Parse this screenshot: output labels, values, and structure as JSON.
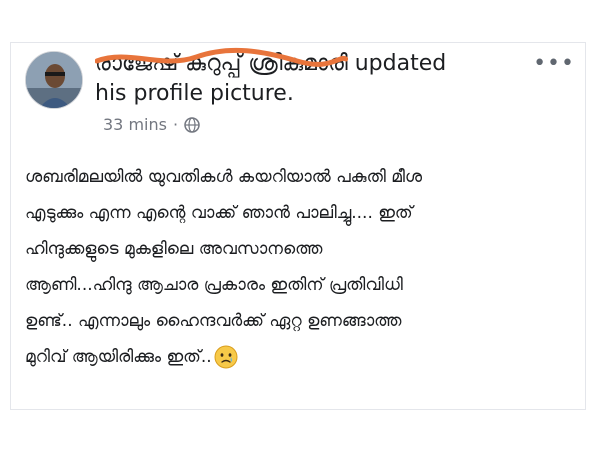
{
  "post": {
    "author_name": "രാജേഷ് കുറുപ്പ് ശ്രീകുമാരി",
    "action_text_1": "updated",
    "action_text_2": "his profile picture.",
    "timestamp": "33 mins",
    "separator": "·",
    "privacy_icon": "globe-icon",
    "more_label": "•••",
    "body_lines": [
      "ശബരിമലയിൽ യുവതികൾ കയറിയാൽ പകുതി മീശ",
      "എടുക്കും എന്ന എന്റെ വാക്ക് ഞാൻ പാലിച്ചു.... ഇത്",
      "ഹിന്ദുക്കളുടെ മുകളിലെ അവസാനത്തെ",
      "ആണി...ഹിന്ദു ആചാര പ്രകാരം ഇതിന് പ്രതിവിധി",
      "ഉണ്ട്.. എന്നാലും ഹൈന്ദവർക്ക് ഏറ്റ ഉണങ്ങാത്ത",
      "മുറിവ് ആയിരിക്കും ഇത്.."
    ],
    "emoji_icon": "crying-face-icon"
  },
  "colors": {
    "scribble": "#e8743b",
    "text": "#1c1e21",
    "muted": "#737780"
  }
}
